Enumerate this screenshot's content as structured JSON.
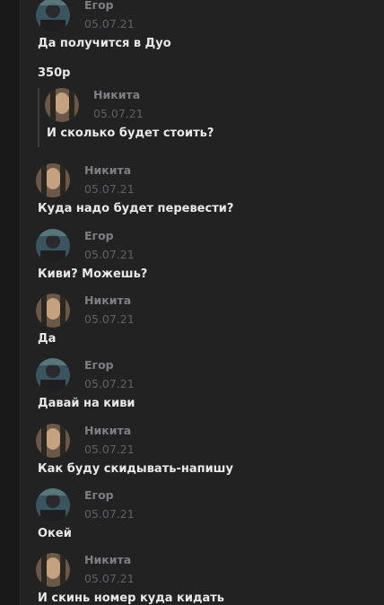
{
  "avatars": {
    "egor": {
      "bg": "#3a5560",
      "fg": "#1f1f22",
      "accent": "#6d8c8e"
    },
    "nikita": {
      "bg": "#6b5848",
      "fg": "#c4a27f",
      "accent": "#2c2620"
    }
  },
  "messages": [
    {
      "author": "Егор",
      "date": "05.07.21",
      "text": "Да получится в Дуо"
    },
    {
      "text": "350р"
    },
    {
      "author": "Никита",
      "date": "05.07.21",
      "text": "И сколько будет стоить?",
      "quoted": true
    },
    {
      "author": "Никита",
      "date": "05.07.21",
      "text": "Куда надо будет перевести?"
    },
    {
      "author": "Егор",
      "date": "05.07.21",
      "text": "Киви? Можешь?"
    },
    {
      "author": "Никита",
      "date": "05.07.21",
      "text": "Да"
    },
    {
      "author": "Егор",
      "date": "05.07.21",
      "text": "Давай на киви"
    },
    {
      "author": "Никита",
      "date": "05.07.21",
      "text": "Как буду скидывать-напишу"
    },
    {
      "author": "Егор",
      "date": "05.07.21",
      "text": "Окей"
    },
    {
      "author": "Никита",
      "date": "05.07.21",
      "text": "И скинь номер куда кидать"
    }
  ]
}
